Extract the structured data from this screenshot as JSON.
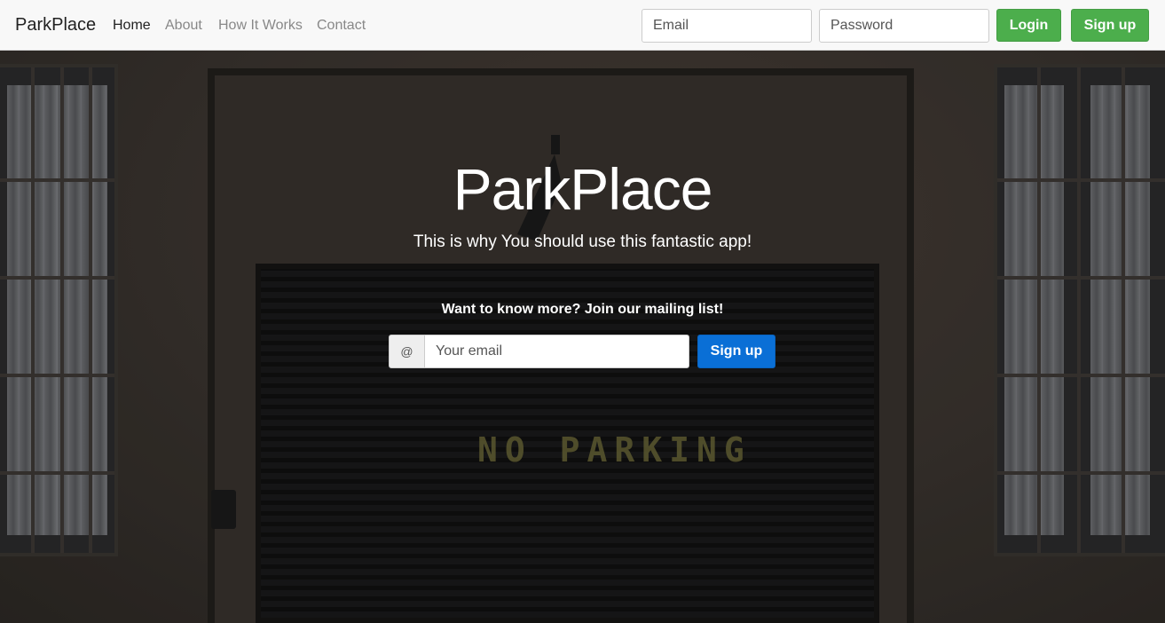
{
  "navbar": {
    "brand": "ParkPlace",
    "links": [
      {
        "label": "Home",
        "active": true
      },
      {
        "label": "About",
        "active": false
      },
      {
        "label": "How It Works",
        "active": false
      },
      {
        "label": "Contact",
        "active": false
      }
    ],
    "email_placeholder": "Email",
    "password_placeholder": "Password",
    "login_label": "Login",
    "signup_label": "Sign up"
  },
  "hero": {
    "background_text": "NO PARKING",
    "title": "ParkPlace",
    "subtitle": "This is why You should use this fantastic app!",
    "mailing_prompt": "Want to know more? Join our mailing list!",
    "at_symbol": "@",
    "email_placeholder": "Your email",
    "signup_label": "Sign up"
  },
  "colors": {
    "navbar_bg": "#f8f8f8",
    "green_button": "#4cae4c",
    "blue_button": "#0a6fd6"
  }
}
